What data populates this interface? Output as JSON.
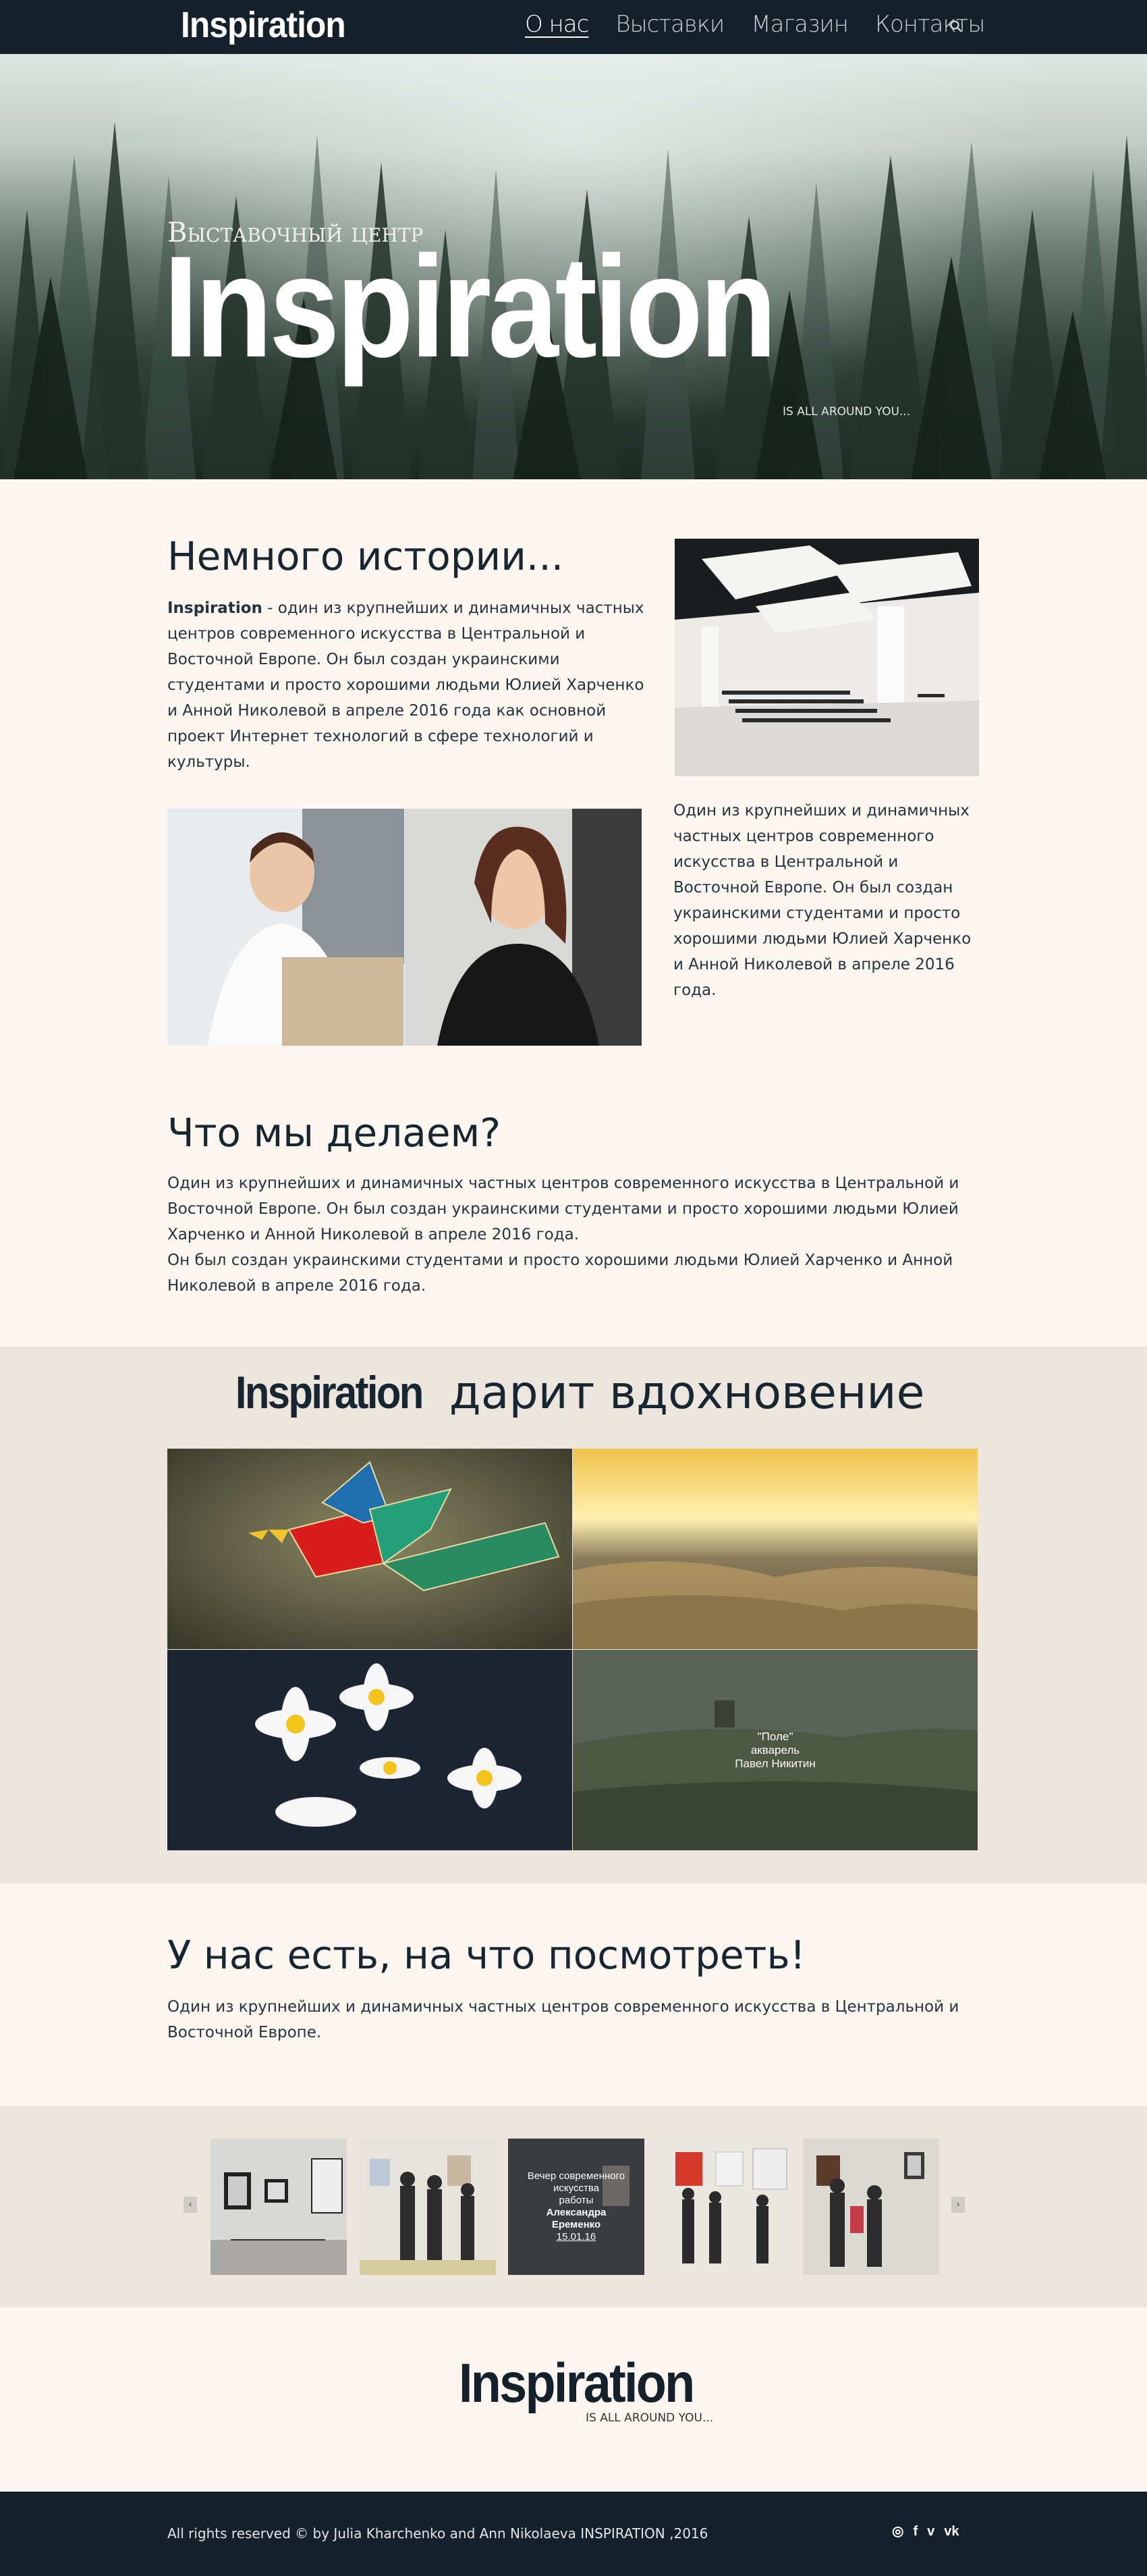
{
  "nav": {
    "logo": "Inspiration",
    "items": [
      {
        "label": "О нас",
        "active": true
      },
      {
        "label": "Выставки",
        "active": false
      },
      {
        "label": "Магазин",
        "active": false
      },
      {
        "label": "Контакты",
        "active": false
      }
    ],
    "search_icon": "search-icon"
  },
  "hero": {
    "subtitle": "Выставочный центр",
    "title": "Inspiration",
    "tagline": "IS ALL AROUND YOU..."
  },
  "history": {
    "title": "Немного истории...",
    "brand": "Inspiration",
    "text": " - один из крупнейших и динамичных частных центров современного искусства в Центральной и Восточной Европе. Он был создан украинскими студентами и просто хорошими людьми Юлией Харченко и Анной Николевой в апреле 2016 года как основной проект Интернет технологий в сфере технологий и культуры.",
    "side_text": "Один из крупнейших и динамичных частных центров современного искусства в Центральной и Восточной Европе. Он был создан украинскими студентами и просто хорошими людьми Юлией Харченко и Анной Николевой в апреле 2016 года."
  },
  "what_we_do": {
    "title": "Что мы делаем?",
    "p1": "Один из крупнейших и динамичных частных центров современного искусства в Центральной и Восточной Европе. Он был создан украинскими студентами и просто хорошими людьми Юлией Харченко и Анной Николевой в апреле 2016 года.",
    "p2": "Он был создан украинскими студентами и просто хорошими людьми Юлией Харченко и Анной Николевой в апреле 2016 года."
  },
  "gallery": {
    "brand": "Inspiration",
    "title_rest": " дарит вдохновение",
    "caption": {
      "line1": "\"Поле\"",
      "line2": "акварель",
      "line3": "Павел Никитин"
    }
  },
  "look": {
    "title": "У нас есть, на что посмотреть!",
    "text": "Один из крупнейших и динамичных частных центров современного искусства в Центральной и Восточной Европе."
  },
  "carousel": {
    "prev_label": "‹",
    "next_label": "›",
    "event": {
      "line1": "Вечер современного",
      "line2": "искусства",
      "line3": "работы",
      "line4": "Александра",
      "line5": "Еременко",
      "date": "15.01.16"
    }
  },
  "footer": {
    "logo": "Inspiration",
    "tagline": "IS ALL AROUND YOU...",
    "copyright": "All rights reserved  ©  by Julia Kharchenko and Ann Nikolaeva  INSPIRATION ,2016",
    "social": [
      {
        "icon": "instagram-icon",
        "glyph": "◎"
      },
      {
        "icon": "facebook-icon",
        "glyph": "f"
      },
      {
        "icon": "vimeo-icon",
        "glyph": "v"
      },
      {
        "icon": "vk-icon",
        "glyph": "vk"
      }
    ]
  },
  "colors": {
    "navy": "#14212b",
    "cream": "#fcf6f1",
    "beige": "#ede6de"
  }
}
